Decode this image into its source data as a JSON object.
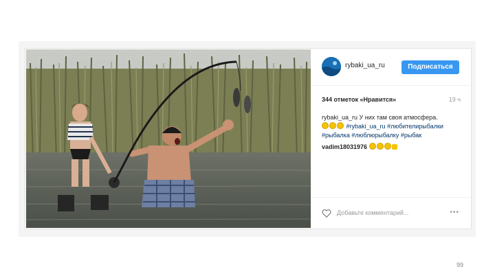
{
  "profile": {
    "username": "rybaki_ua_ru",
    "follow_label": "Подписаться",
    "avatar_icon": "ocean-avatar-icon"
  },
  "post": {
    "likes": "344 отметок «Нравится»",
    "time": "19 ч",
    "caption_user": "rybaki_ua_ru",
    "caption_text": "У них там своя атмосфера.",
    "caption_tag_1": "#rybaki_ua_ru",
    "caption_tag_2": "#любителирыбалки",
    "caption_tag_3": "#рыбалка",
    "caption_tag_4": "#люблюрыбалку",
    "caption_tag_5": "#рыбак",
    "comment_user": "vadim18031976"
  },
  "footer": {
    "comment_placeholder": "Добавьте комментарий...",
    "more_label": "•••"
  },
  "slide": {
    "page_number": "99"
  },
  "colors": {
    "follow_button": "#3897f0",
    "hashtag": "#003569",
    "border": "#efefef"
  }
}
